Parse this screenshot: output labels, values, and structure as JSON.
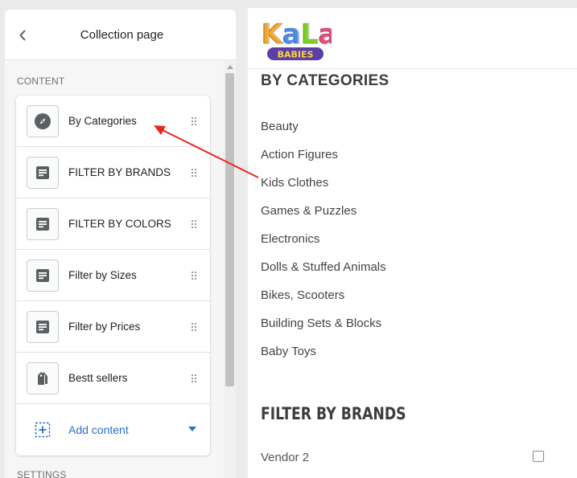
{
  "editor": {
    "title": "Collection page",
    "section_label": "CONTENT",
    "settings_label": "SETTINGS",
    "blocks": [
      {
        "label": "By Categories",
        "icon": "compass-icon"
      },
      {
        "label": "FILTER BY BRANDS",
        "icon": "text-block-icon"
      },
      {
        "label": "FILTER BY COLORS",
        "icon": "text-block-icon"
      },
      {
        "label": "Filter by Sizes",
        "icon": "text-block-icon"
      },
      {
        "label": "Filter by Prices",
        "icon": "text-block-icon"
      },
      {
        "label": "Bestt sellers",
        "icon": "tags-icon"
      }
    ],
    "add_content_label": "Add content",
    "accent_color": "#2c6ecb"
  },
  "preview": {
    "logo": {
      "line1": "KaLa",
      "line2": "BABIES"
    },
    "categories_heading": "BY CATEGORIES",
    "categories": [
      "Beauty",
      "Action Figures",
      "Kids Clothes",
      "Games & Puzzles",
      "Electronics",
      "Dolls & Stuffed Animals",
      "Bikes, Scooters",
      "Building Sets & Blocks",
      "Baby Toys"
    ],
    "brands_heading": "FILTER BY BRANDS",
    "brands": [
      {
        "label": "Vendor 2",
        "checked": false
      }
    ]
  },
  "annotation": {
    "color": "#e8281e",
    "from": "Kids Clothes",
    "to": "By Categories"
  }
}
